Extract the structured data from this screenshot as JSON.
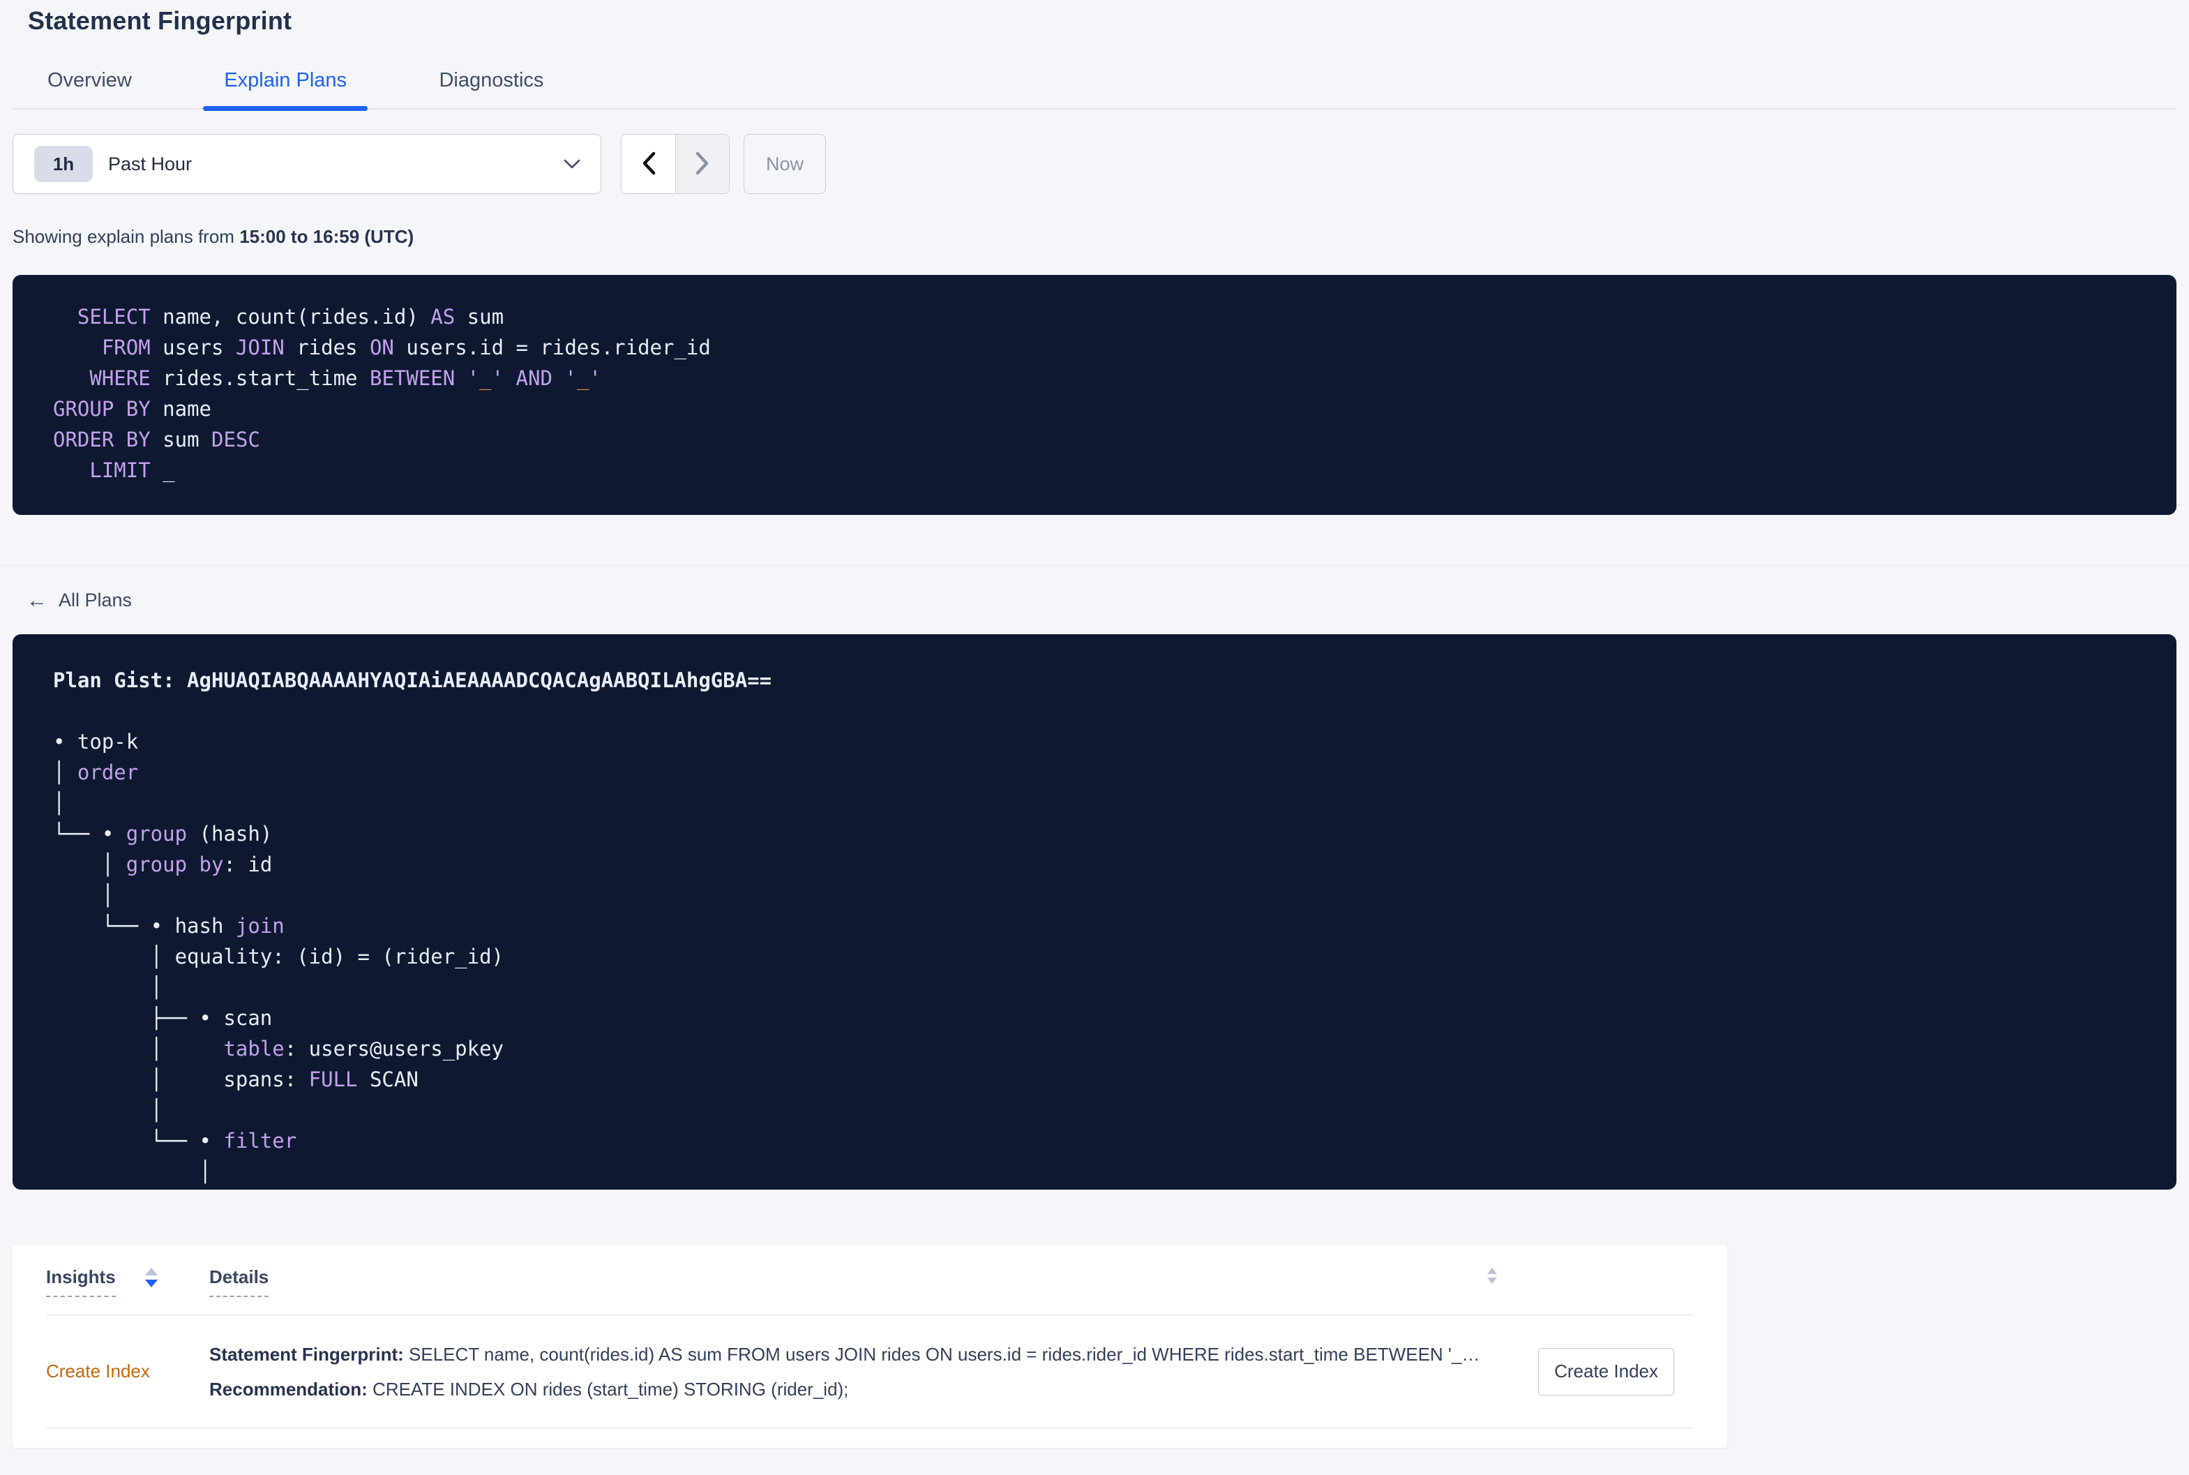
{
  "page": {
    "title": "Statement Fingerprint"
  },
  "tabs": [
    {
      "label": "Overview",
      "active": false
    },
    {
      "label": "Explain Plans",
      "active": true
    },
    {
      "label": "Diagnostics",
      "active": false
    }
  ],
  "time_picker": {
    "badge": "1h",
    "label": "Past Hour",
    "prev_label": "previous time interval",
    "next_label": "next time interval",
    "now_label": "Now"
  },
  "showing": {
    "prefix": "Showing explain plans from ",
    "range": "15:00 to 16:59 (UTC)"
  },
  "sql": {
    "lines": [
      [
        {
          "t": "  "
        },
        {
          "t": "SELECT",
          "c": "kw"
        },
        {
          "t": " name, count(rides.id) "
        },
        {
          "t": "AS",
          "c": "kw"
        },
        {
          "t": " sum"
        }
      ],
      [
        {
          "t": "    "
        },
        {
          "t": "FROM",
          "c": "kw"
        },
        {
          "t": " users "
        },
        {
          "t": "JOIN",
          "c": "kw"
        },
        {
          "t": " rides "
        },
        {
          "t": "ON",
          "c": "kw"
        },
        {
          "t": " users.id = rides.rider_id"
        }
      ],
      [
        {
          "t": "   "
        },
        {
          "t": "WHERE",
          "c": "kw"
        },
        {
          "t": " rides.start_time "
        },
        {
          "t": "BETWEEN",
          "c": "kw"
        },
        {
          "t": " "
        },
        {
          "t": "'",
          "c": "kw"
        },
        {
          "t": "_",
          "c": "str"
        },
        {
          "t": "'",
          "c": "kw"
        },
        {
          "t": " "
        },
        {
          "t": "AND",
          "c": "kw"
        },
        {
          "t": " "
        },
        {
          "t": "'",
          "c": "kw"
        },
        {
          "t": "_",
          "c": "str"
        },
        {
          "t": "'",
          "c": "kw"
        }
      ],
      [
        {
          "t": "GROUP BY",
          "c": "kw"
        },
        {
          "t": " name"
        }
      ],
      [
        {
          "t": "ORDER BY",
          "c": "kw"
        },
        {
          "t": " sum "
        },
        {
          "t": "DESC",
          "c": "kw"
        }
      ],
      [
        {
          "t": "   "
        },
        {
          "t": "LIMIT",
          "c": "kw"
        },
        {
          "t": " _"
        }
      ]
    ]
  },
  "back_link": {
    "label": "All Plans"
  },
  "plan": {
    "gist": "Plan Gist: AgHUAQIABQAAAAHYAQIAiAEAAAADCQACAgAABQILAhgGBA==",
    "lines": [
      [
        {
          "t": "Plan Gist: AgHUAQIABQAAAAHYAQIAiAEAAAADCQACAgAABQILAhgGBA==",
          "c": "bold"
        }
      ],
      [
        {
          "t": ""
        }
      ],
      [
        {
          "t": "• top-k"
        }
      ],
      [
        {
          "t": "│ "
        },
        {
          "t": "order",
          "c": "kw"
        }
      ],
      [
        {
          "t": "│"
        }
      ],
      [
        {
          "t": "└── • "
        },
        {
          "t": "group",
          "c": "kw"
        },
        {
          "t": " (hash)"
        }
      ],
      [
        {
          "t": "    │ "
        },
        {
          "t": "group by",
          "c": "kw"
        },
        {
          "t": ": id"
        }
      ],
      [
        {
          "t": "    │"
        }
      ],
      [
        {
          "t": "    └── • hash "
        },
        {
          "t": "join",
          "c": "kw"
        }
      ],
      [
        {
          "t": "        │ equality: (id) = (rider_id)"
        }
      ],
      [
        {
          "t": "        │"
        }
      ],
      [
        {
          "t": "        ├── • scan"
        }
      ],
      [
        {
          "t": "        │     "
        },
        {
          "t": "table",
          "c": "kw"
        },
        {
          "t": ": users@users_pkey"
        }
      ],
      [
        {
          "t": "        │     spans: "
        },
        {
          "t": "FULL",
          "c": "kw"
        },
        {
          "t": " SCAN"
        }
      ],
      [
        {
          "t": "        │"
        }
      ],
      [
        {
          "t": "        └── • "
        },
        {
          "t": "filter",
          "c": "kw"
        }
      ],
      [
        {
          "t": "            │"
        }
      ]
    ]
  },
  "insights_table": {
    "columns": [
      "Insights",
      "Details"
    ],
    "rows": [
      {
        "insight": "Create Index",
        "detail_lines": [
          {
            "label": "Statement Fingerprint:",
            "text": " SELECT name, count(rides.id) AS sum FROM users JOIN rides ON users.id = rides.rider_id WHERE rides.start_time BETWEEN '_…"
          },
          {
            "label": "Recommendation:",
            "text": " CREATE INDEX ON rides (start_time) STORING (rider_id);"
          }
        ],
        "action": "Create Index"
      }
    ]
  },
  "colors": {
    "accent_blue": "#2061f2",
    "link_orange": "#c2690f",
    "code_background": "#0e1931",
    "code_keyword": "#c2a2ea",
    "code_string": "#e0913f",
    "page_background": "#f4f6fa"
  }
}
